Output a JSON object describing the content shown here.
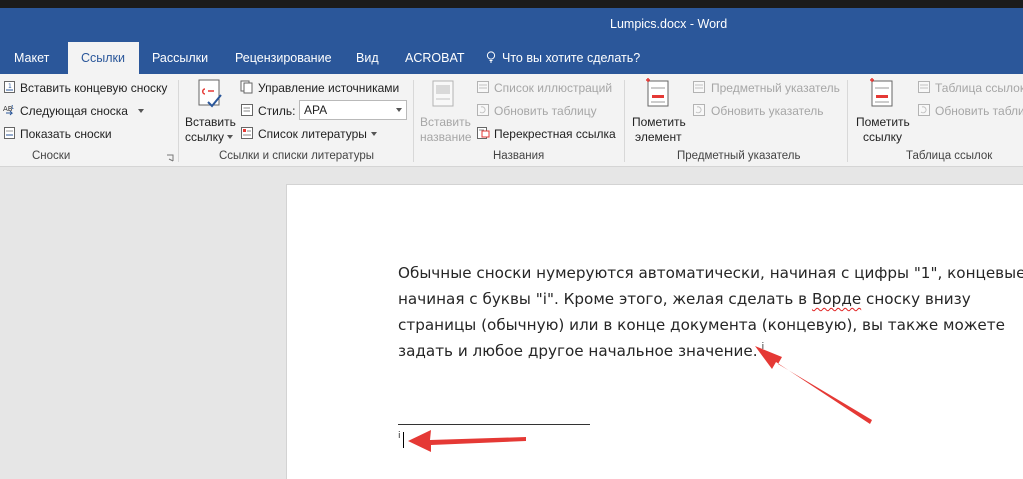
{
  "window": {
    "title": "Lumpics.docx - Word"
  },
  "tabs": [
    {
      "label": "Макет",
      "active": false
    },
    {
      "label": "Ссылки",
      "active": true
    },
    {
      "label": "Рассылки",
      "active": false
    },
    {
      "label": "Рецензирование",
      "active": false
    },
    {
      "label": "Вид",
      "active": false
    },
    {
      "label": "ACROBAT",
      "active": false
    }
  ],
  "tell_me": {
    "placeholder": "Что вы хотите сделать?",
    "icon": "lightbulb-icon"
  },
  "ribbon": {
    "footnotes": {
      "insert_endnote": "Вставить концевую сноску",
      "next_footnote": "Следующая сноска",
      "show_notes": "Показать сноски",
      "group_label": "Сноски"
    },
    "citations": {
      "insert_citation_line1": "Вставить",
      "insert_citation_line2": "ссылку",
      "manage_sources": "Управление источниками",
      "style_label": "Стиль:",
      "style_value": "APA",
      "bibliography": "Список литературы",
      "group_label": "Ссылки и списки литературы"
    },
    "captions": {
      "insert_caption_line1": "Вставить",
      "insert_caption_line2": "название",
      "table_of_figures": "Список иллюстраций",
      "update_table": "Обновить таблицу",
      "cross_reference": "Перекрестная ссылка",
      "group_label": "Названия"
    },
    "index": {
      "mark_entry_line1": "Пометить",
      "mark_entry_line2": "элемент",
      "insert_index": "Предметный указатель",
      "update_index": "Обновить указатель",
      "group_label": "Предметный указатель"
    },
    "authorities": {
      "mark_citation_line1": "Пометить",
      "mark_citation_line2": "ссылку",
      "insert_table": "Таблица ссылок",
      "update_table": "Обновить табли",
      "group_label": "Таблица ссылок"
    }
  },
  "document": {
    "lines": [
      "Обычные сноски нумеруются автоматически, начиная с цифры \"1\", концевые -",
      "начиная с буквы \"i\". Кроме этого, желая сделать в ",
      "Ворде",
      " сноску внизу",
      "страницы (обычную) или в конце документа (концевую), вы также можете",
      "задать и любое другое начальное значение."
    ],
    "endnote_mark": "i",
    "footnote_mark": "i"
  },
  "colors": {
    "word_blue": "#2b579a",
    "arrow_red": "#e53935"
  }
}
